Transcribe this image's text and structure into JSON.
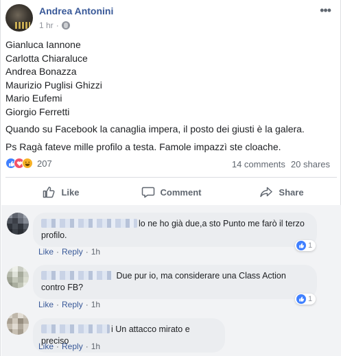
{
  "post": {
    "author": "Andrea Antonini",
    "time": "1 hr",
    "more_icon": "ellipsis-icon",
    "privacy_icon": "globe-icon",
    "names": [
      "Gianluca Iannone",
      "Carlotta Chiaraluce",
      "Andrea Bonazza",
      "Maurizio Puglisi Ghizzi",
      "Mario Eufemi",
      "Giorgio Ferretti"
    ],
    "paragraph1": "Quando su Facebook la canaglia impera, il posto dei giusti è la galera.",
    "paragraph2": "Ps Ragà fateve mille profilo a testa. Famole impazzì ste cloache."
  },
  "stats": {
    "reaction_count": "207",
    "comments": "14 comments",
    "shares": "20 shares"
  },
  "actions": {
    "like": "Like",
    "comment": "Comment",
    "share": "Share"
  },
  "comments": [
    {
      "prefix": "",
      "text": "lo ne ho già due,a sto Punto me farò il terzo profilo.",
      "like_label": "Like",
      "reply_label": "Reply",
      "time": "1h",
      "likes": "1"
    },
    {
      "prefix": "",
      "text": "Due pur io, ma considerare una Class Action contro FB?",
      "like_label": "Like",
      "reply_label": "Reply",
      "time": "1h",
      "likes": "1"
    },
    {
      "prefix": "i",
      "text": "Un attacco mirato e preciso",
      "like_label": "Like",
      "reply_label": "Reply",
      "time": "1h",
      "likes": ""
    }
  ],
  "colors": {
    "link_blue": "#385898",
    "like_blue": "#4080ff",
    "love_red": "#f25268",
    "haha_yellow": "#f7b125",
    "comment_bg": "#f2f3f5",
    "bubble_bg": "#ebedf0"
  }
}
